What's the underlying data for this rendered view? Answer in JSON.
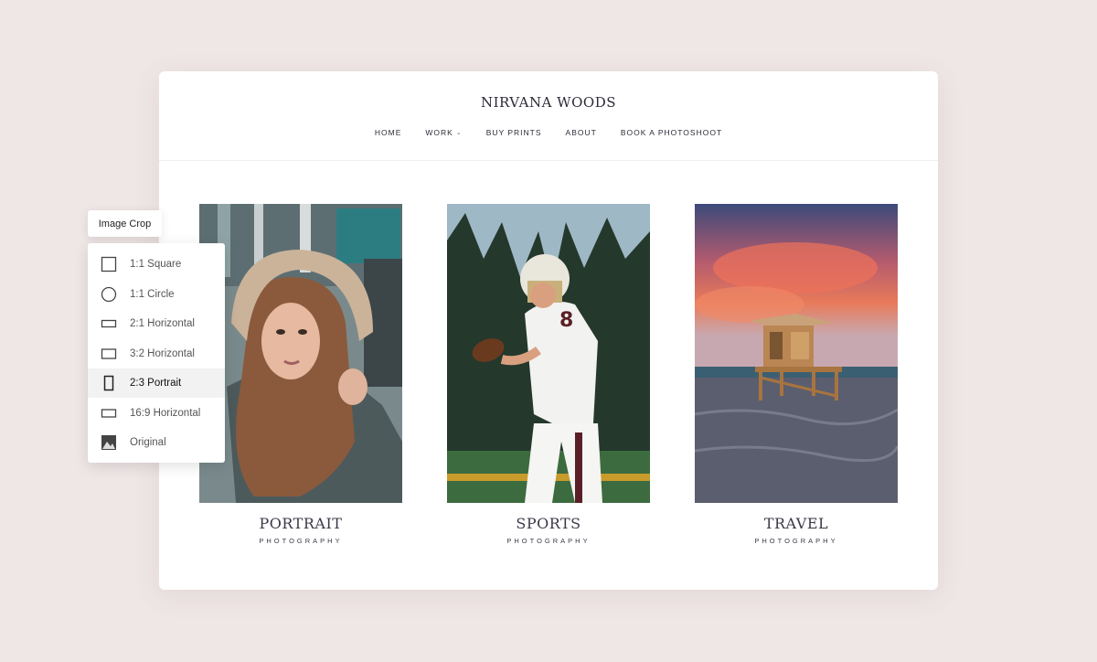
{
  "site": {
    "title": "NIRVANA WOODS",
    "nav": [
      {
        "label": "HOME"
      },
      {
        "label": "WORK"
      },
      {
        "label": "BUY PRINTS"
      },
      {
        "label": "ABOUT"
      },
      {
        "label": "BOOK A PHOTOSHOOT"
      }
    ],
    "nav_work_chevron": "⌄"
  },
  "tiles": [
    {
      "title": "PORTRAIT",
      "subtitle": "PHOTOGRAPHY"
    },
    {
      "title": "SPORTS",
      "subtitle": "PHOTOGRAPHY"
    },
    {
      "title": "TRAVEL",
      "subtitle": "PHOTOGRAPHY"
    }
  ],
  "image_crop": {
    "label": "Image Crop",
    "options": [
      {
        "label": "1:1 Square",
        "icon": "square-icon"
      },
      {
        "label": "1:1 Circle",
        "icon": "circle-icon"
      },
      {
        "label": "2:1 Horizontal",
        "icon": "horizontal-2-1-icon"
      },
      {
        "label": "3:2 Horizontal",
        "icon": "horizontal-3-2-icon"
      },
      {
        "label": "2:3 Portrait",
        "icon": "portrait-2-3-icon",
        "selected": true
      },
      {
        "label": "16:9 Horizontal",
        "icon": "horizontal-16-9-icon"
      },
      {
        "label": "Original",
        "icon": "image-icon"
      }
    ]
  },
  "colors": {
    "background": "#efe6e6",
    "card": "#ffffff",
    "text": "#2b2b38",
    "selected_row": "#f2f2f2"
  }
}
